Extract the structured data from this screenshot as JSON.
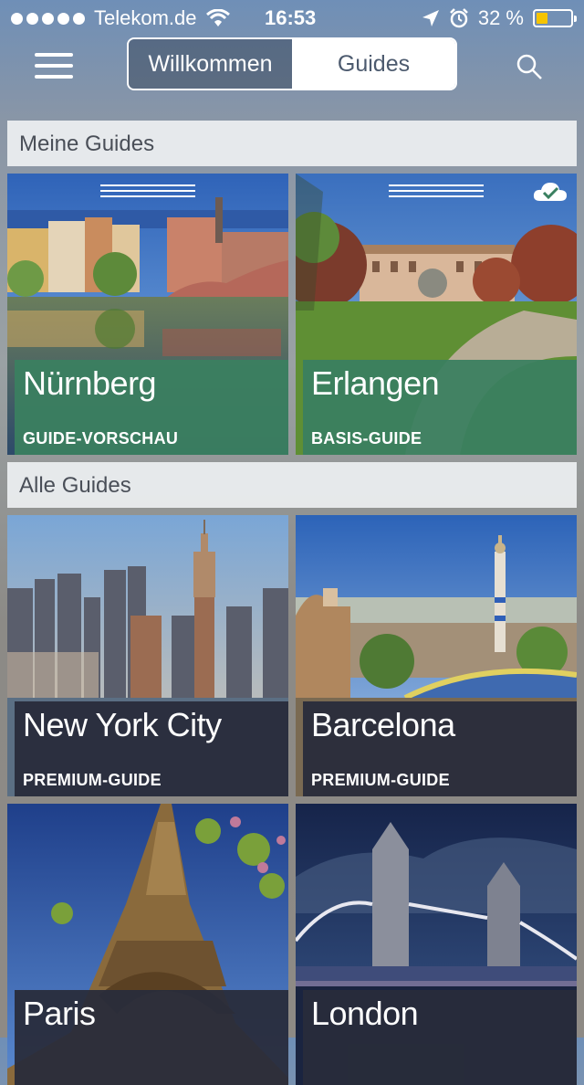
{
  "status_bar": {
    "carrier": "Telekom.de",
    "time": "16:53",
    "battery": "32 %",
    "battery_level": 0.32
  },
  "nav": {
    "tabs": [
      "Willkommen",
      "Guides"
    ],
    "active_tab": "Guides"
  },
  "sections": {
    "mine_title": "Meine Guides",
    "all_title": "Alle Guides"
  },
  "mine": [
    {
      "city": "Nürnberg",
      "type": "GUIDE-VORSCHAU"
    },
    {
      "city": "Erlangen",
      "type": "BASIS-GUIDE"
    }
  ],
  "all": [
    {
      "city": "New York City",
      "type": "PREMIUM-GUIDE"
    },
    {
      "city": "Barcelona",
      "type": "PREMIUM-GUIDE"
    },
    {
      "city": "Paris",
      "type": ""
    },
    {
      "city": "London",
      "type": ""
    }
  ],
  "colors": {
    "accent_green": "#3a8060",
    "dark_label": "#282c3a",
    "battery": "#f5c400"
  }
}
